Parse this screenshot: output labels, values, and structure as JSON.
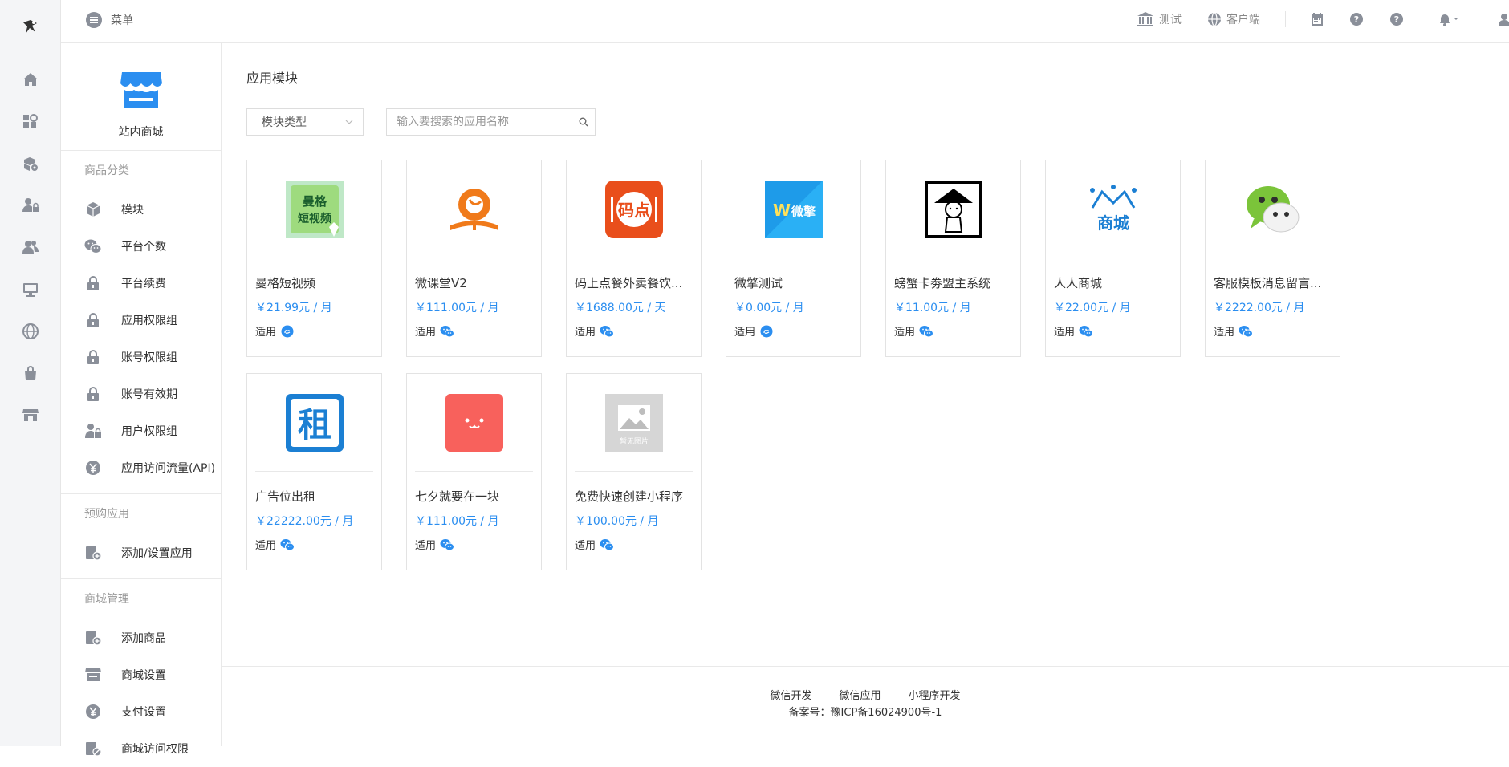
{
  "topbar": {
    "menu_label": "菜单",
    "items": [
      {
        "label": "测试",
        "icon": "bank-icon"
      },
      {
        "label": "客户端",
        "icon": "globe-icon"
      }
    ],
    "icons": [
      "calendar-icon",
      "help-icon",
      "question-icon",
      "bell-icon",
      "user-icon"
    ]
  },
  "rail": {
    "icons": [
      "logo-icon",
      "home-icon",
      "apps-icon",
      "module-settings-icon",
      "user-lock-icon",
      "users-icon",
      "monitor-icon",
      "globe-icon",
      "bag-icon",
      "store-icon"
    ]
  },
  "sidebar": {
    "shop_label": "站内商城",
    "sections": [
      {
        "title": "商品分类",
        "items": [
          {
            "label": "模块",
            "icon": "cube-icon"
          },
          {
            "label": "平台个数",
            "icon": "wechat-icon"
          },
          {
            "label": "平台续费",
            "icon": "lock-icon"
          },
          {
            "label": "应用权限组",
            "icon": "lock-icon"
          },
          {
            "label": "账号权限组",
            "icon": "lock-icon"
          },
          {
            "label": "账号有效期",
            "icon": "lock-icon"
          },
          {
            "label": "用户权限组",
            "icon": "user-lock-icon"
          },
          {
            "label": "应用访问流量(API)",
            "icon": "yen-icon"
          }
        ]
      },
      {
        "title": "预购应用",
        "items": [
          {
            "label": "添加/设置应用",
            "icon": "add-app-icon"
          }
        ]
      },
      {
        "title": "商城管理",
        "items": [
          {
            "label": "添加商品",
            "icon": "add-app-icon"
          },
          {
            "label": "商城设置",
            "icon": "store-icon"
          },
          {
            "label": "支付设置",
            "icon": "yen-icon"
          },
          {
            "label": "商城访问权限",
            "icon": "ban-icon"
          }
        ]
      }
    ]
  },
  "main": {
    "title": "应用模块",
    "filter_label": "模块类型",
    "search_placeholder": "输入要搜索的应用名称",
    "fit_label": "适用",
    "cards": [
      {
        "name": "曼格短视频",
        "price": "￥21.99元 / 月",
        "platform": "miniapp-icon",
        "img_text": "曼格短视频"
      },
      {
        "name": "微课堂V2",
        "price": "￥111.00元 / 月",
        "platform": "wechat-icon",
        "img_text": ""
      },
      {
        "name": "码上点餐外卖餐饮...",
        "price": "￥1688.00元 / 天",
        "platform": "wechat-icon",
        "img_text": "码点"
      },
      {
        "name": "微擎测试",
        "price": "￥0.00元 / 月",
        "platform": "miniapp-icon",
        "img_text": "微擎"
      },
      {
        "name": "螃蟹卡劵盟主系统",
        "price": "￥11.00元 / 月",
        "platform": "wechat-icon",
        "img_text": ""
      },
      {
        "name": "人人商城",
        "price": "￥22.00元 / 月",
        "platform": "wechat-icon",
        "img_text": "商城"
      },
      {
        "name": "客服模板消息留言...",
        "price": "￥2222.00元 / 月",
        "platform": "wechat-icon",
        "img_text": ""
      },
      {
        "name": "广告位出租",
        "price": "￥22222.00元 / 月",
        "platform": "wechat-icon",
        "img_text": "租"
      },
      {
        "name": "七夕就要在一块",
        "price": "￥111.00元 / 月",
        "platform": "wechat-icon",
        "img_text": ""
      },
      {
        "name": "免费快速创建小程序",
        "price": "￥100.00元 / 月",
        "platform": "wechat-icon",
        "img_text": "暂无图片"
      }
    ]
  },
  "footer": {
    "links": [
      "微信开发",
      "微信应用",
      "小程序开发"
    ],
    "icp": "备案号：豫ICP备16024900号-1"
  },
  "colors": {
    "accent": "#2b8ef0",
    "icon_gray": "#8a8f99"
  }
}
